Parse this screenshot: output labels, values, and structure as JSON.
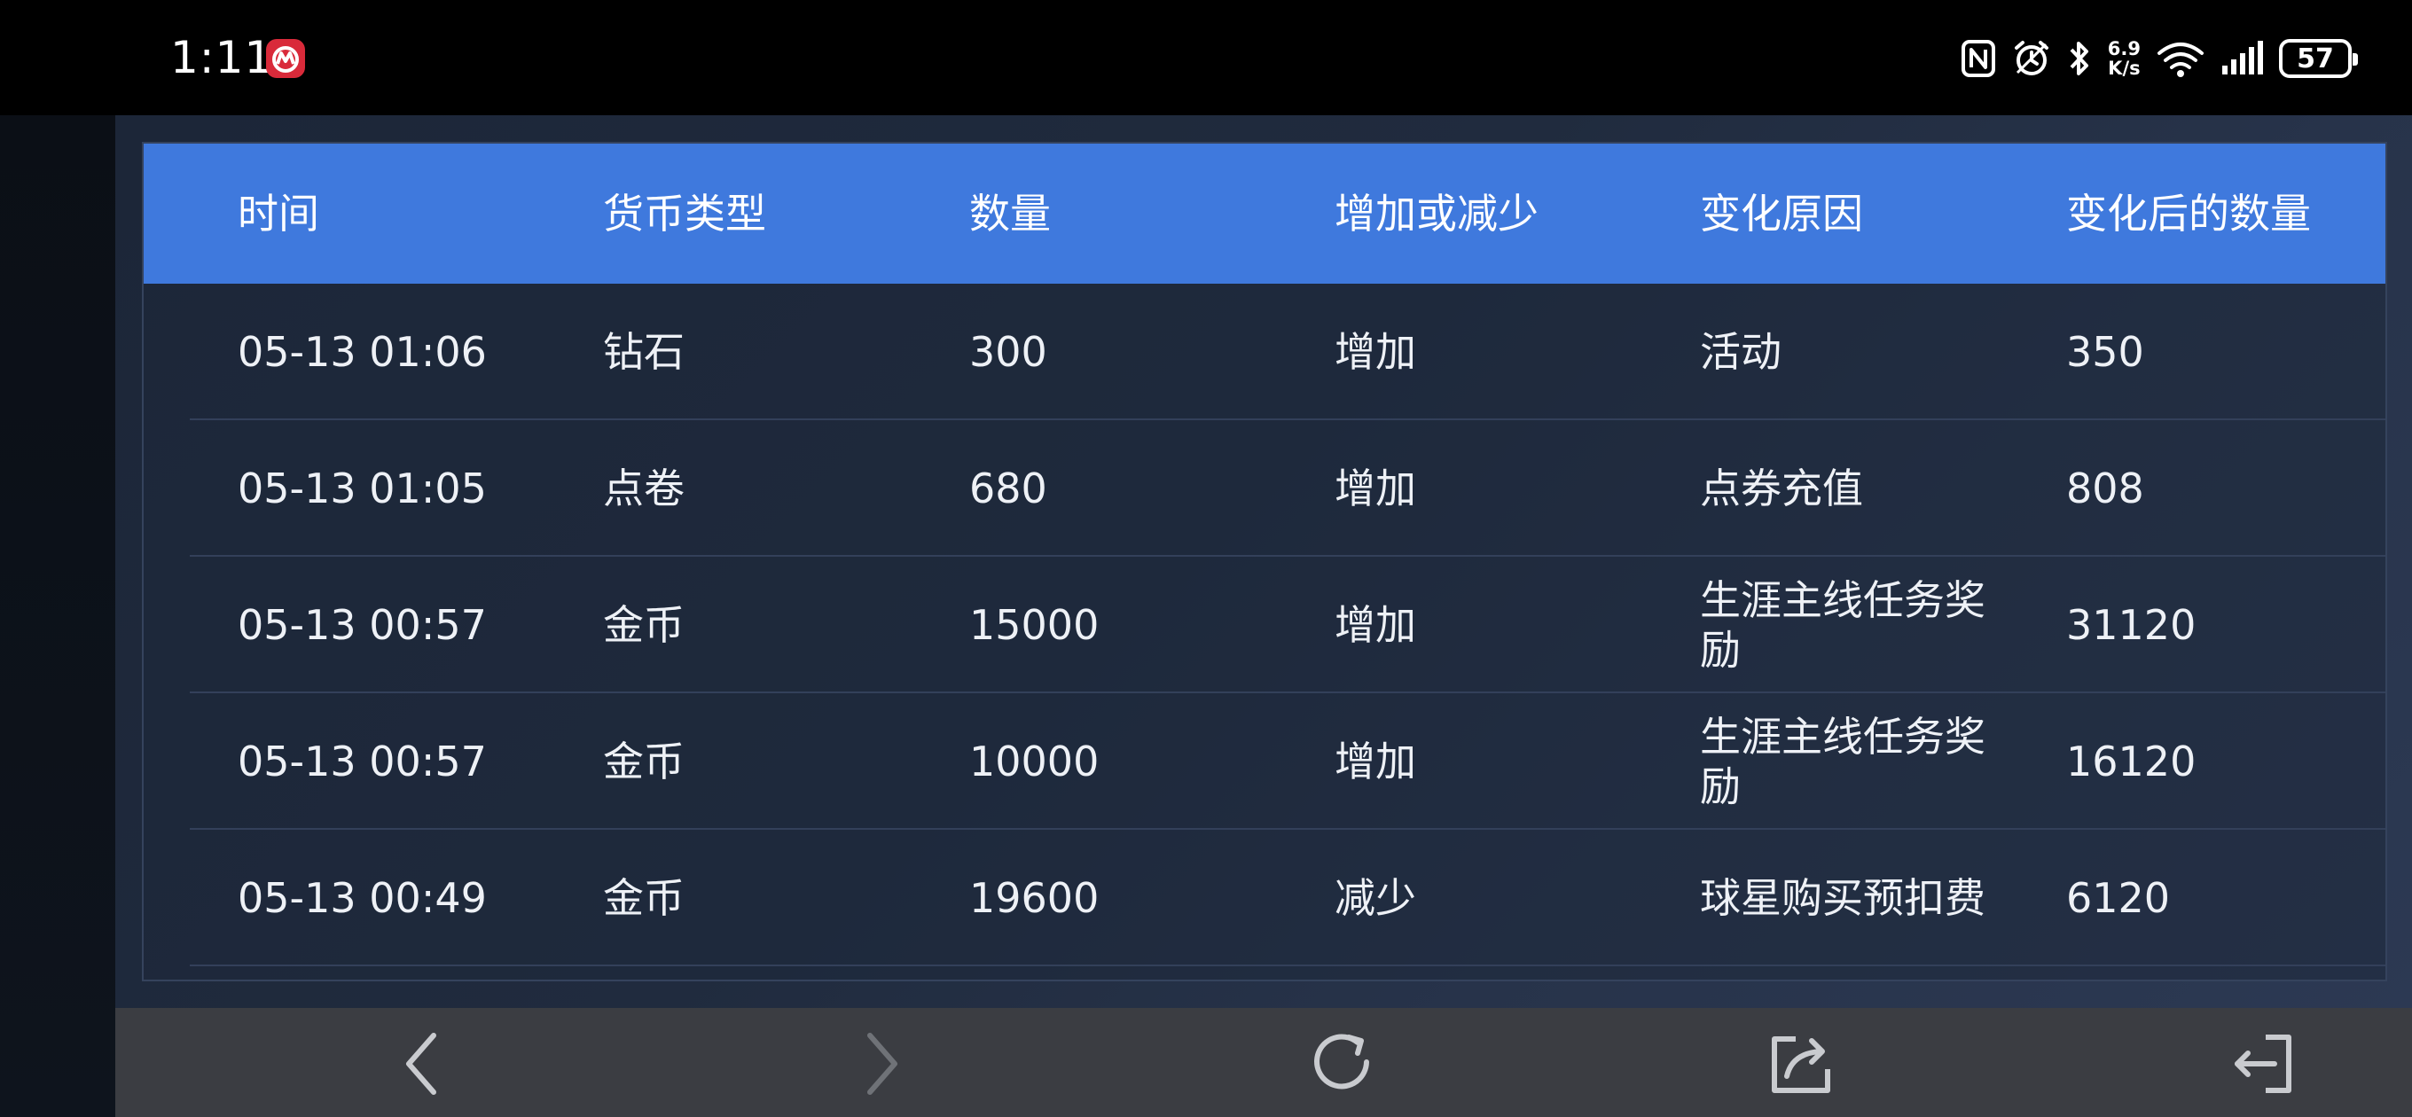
{
  "status_bar": {
    "time": "1:11",
    "net_speed_value": "6.9",
    "net_speed_unit": "K/s",
    "battery": "57",
    "icons": [
      "app-notification-icon",
      "nfc-icon",
      "alarm-icon",
      "bluetooth-icon",
      "wifi-icon",
      "signal-icon",
      "battery-icon"
    ]
  },
  "table": {
    "headers": [
      "时间",
      "货币类型",
      "数量",
      "增加或减少",
      "变化原因",
      "变化后的数量"
    ],
    "rows": [
      {
        "time": "05-13 01:06",
        "currency": "钻石",
        "amount": "300",
        "direction": "增加",
        "reason": "活动",
        "after": "350"
      },
      {
        "time": "05-13 01:05",
        "currency": "点卷",
        "amount": "680",
        "direction": "增加",
        "reason": "点券充值",
        "after": "808"
      },
      {
        "time": "05-13 00:57",
        "currency": "金币",
        "amount": "15000",
        "direction": "增加",
        "reason": "生涯主线任务奖励",
        "after": "31120"
      },
      {
        "time": "05-13 00:57",
        "currency": "金币",
        "amount": "10000",
        "direction": "增加",
        "reason": "生涯主线任务奖励",
        "after": "16120"
      },
      {
        "time": "05-13 00:49",
        "currency": "金币",
        "amount": "19600",
        "direction": "减少",
        "reason": "球星购买预扣费",
        "after": "6120"
      }
    ]
  },
  "bottom_nav": {
    "buttons": [
      "back-icon",
      "forward-icon",
      "refresh-icon",
      "share-icon",
      "exit-icon"
    ]
  },
  "colors": {
    "header_blue": "#3f79dd",
    "panel_bg": "#1e283a",
    "nav_bg": "#3b3d42",
    "status_bar_bg": "#000000"
  }
}
